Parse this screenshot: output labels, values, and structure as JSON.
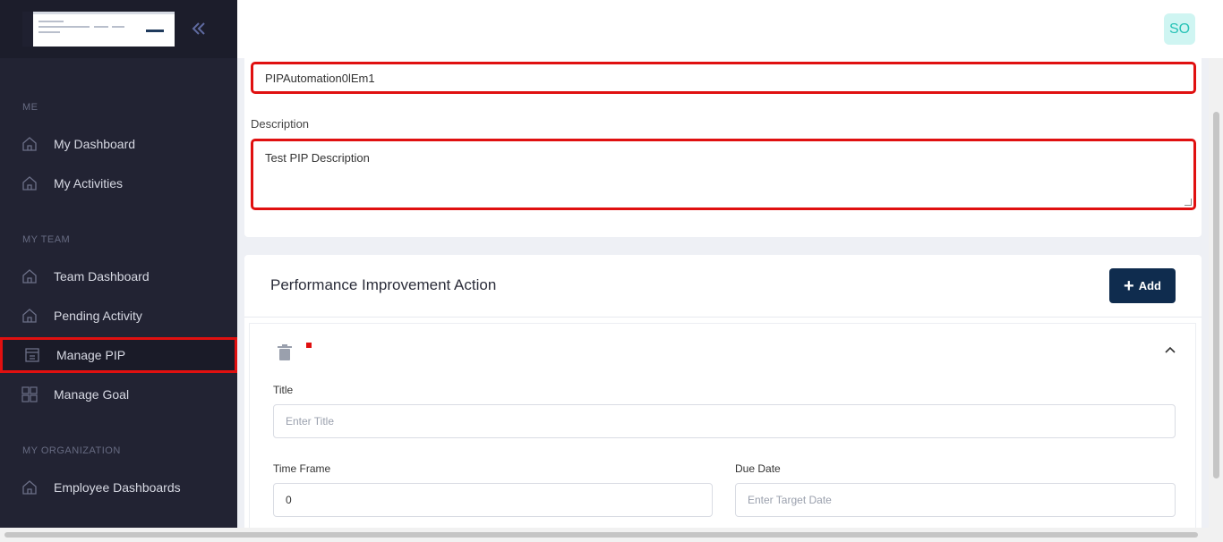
{
  "sidebar": {
    "sections": {
      "me": "ME",
      "my_team": "MY TEAM",
      "my_org": "MY ORGANIZATION"
    },
    "items": {
      "my_dashboard": "My Dashboard",
      "my_activities": "My Activities",
      "team_dashboard": "Team Dashboard",
      "pending_activity": "Pending Activity",
      "manage_pip": "Manage PIP",
      "manage_goal": "Manage Goal",
      "employee_dashboards": "Employee Dashboards"
    }
  },
  "header": {
    "avatar_initials": "SO"
  },
  "pip_form": {
    "name_value": "PIPAutomation0lEm1",
    "description_label": "Description",
    "description_value": "Test PIP Description"
  },
  "action_section": {
    "title": "Performance Improvement Action",
    "add_label": "Add",
    "title_label": "Title",
    "title_placeholder": "Enter Title",
    "time_frame_label": "Time Frame",
    "time_frame_value": "0",
    "due_date_label": "Due Date",
    "due_date_placeholder": "Enter Target Date"
  },
  "colors": {
    "highlight": "#e01010",
    "sidebar_bg": "#222333",
    "primary_button": "#0f2c4e",
    "avatar_bg": "#cff5f2"
  }
}
